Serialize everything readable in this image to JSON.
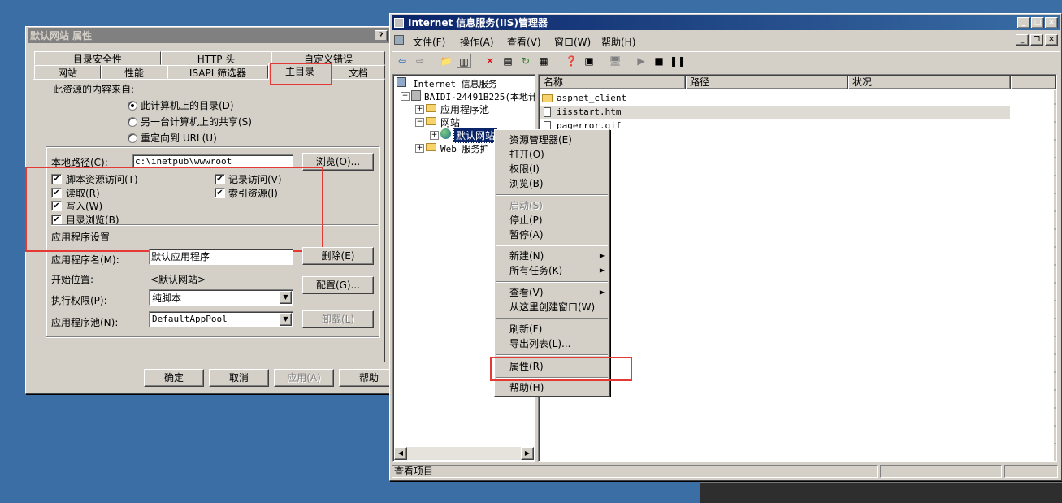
{
  "desktop_bg": "#3a6ea5",
  "props": {
    "title": "默认网站 属性",
    "help_btn": "?",
    "tabs_back": [
      "目录安全性",
      "HTTP 头",
      "自定义错误"
    ],
    "tabs_front": [
      "网站",
      "性能",
      "ISAPI 筛选器",
      "主目录",
      "文档"
    ],
    "source_label": "此资源的内容来自:",
    "radios": [
      "此计算机上的目录(D)",
      "另一台计算机上的共享(S)",
      "重定向到 URL(U)"
    ],
    "local_path_label": "本地路径(C):",
    "local_path_value": "c:\\inetpub\\wwwroot",
    "browse_btn": "浏览(O)...",
    "checks_left": [
      "脚本资源访问(T)",
      "读取(R)",
      "写入(W)",
      "目录浏览(B)"
    ],
    "checks_right": [
      "记录访问(V)",
      "索引资源(I)"
    ],
    "app_settings_label": "应用程序设置",
    "app_name_label": "应用程序名(M):",
    "app_name_value": "默认应用程序",
    "remove_btn": "删除(E)",
    "start_point_label": "开始位置:",
    "start_point_value": "<默认网站>",
    "config_btn": "配置(G)...",
    "exec_perm_label": "执行权限(P):",
    "exec_perm_value": "纯脚本",
    "app_pool_label": "应用程序池(N):",
    "app_pool_value": "DefaultAppPool",
    "unload_btn": "卸载(L)",
    "ok_btn": "确定",
    "cancel_btn": "取消",
    "apply_btn": "应用(A)",
    "help_btn2": "帮助"
  },
  "iis": {
    "title": "Internet 信息服务(IIS)管理器",
    "menu": [
      "文件(F)",
      "操作(A)",
      "查看(V)",
      "窗口(W)",
      "帮助(H)"
    ],
    "tree": {
      "root": "Internet 信息服务",
      "server": "BAIDI-24491B225(本地计",
      "app_pools": "应用程序池",
      "websites": "网站",
      "default_site": "默认网站",
      "web_ext": "Web 服务扩"
    },
    "columns": [
      "名称",
      "路径",
      "状况"
    ],
    "files": [
      "aspnet_client",
      "iisstart.htm",
      "pagerror.gif"
    ],
    "status_text": "查看项目"
  },
  "context_menu": {
    "group1": [
      "资源管理器(E)",
      "打开(O)",
      "权限(I)",
      "浏览(B)"
    ],
    "group2_disabled": "启动(S)",
    "group2": [
      "停止(P)",
      "暂停(A)"
    ],
    "group3": [
      "新建(N)",
      "所有任务(K)"
    ],
    "group4": [
      "查看(V)",
      "从这里创建窗口(W)"
    ],
    "group5": [
      "刷新(F)",
      "导出列表(L)..."
    ],
    "properties": "属性(R)",
    "help": "帮助(H)"
  }
}
